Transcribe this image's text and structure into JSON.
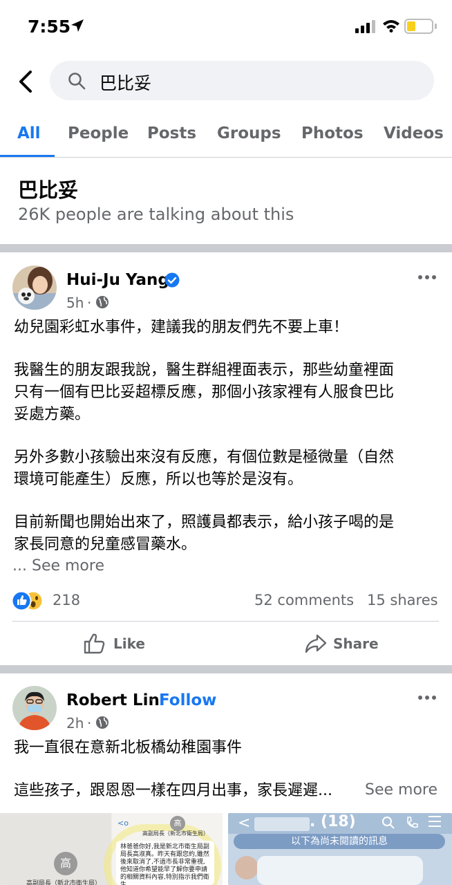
{
  "status_bar": {
    "time": "7:55"
  },
  "search": {
    "query": "巴比妥"
  },
  "tabs": [
    {
      "label": "All"
    },
    {
      "label": "People"
    },
    {
      "label": "Posts"
    },
    {
      "label": "Groups"
    },
    {
      "label": "Photos"
    },
    {
      "label": "Videos"
    }
  ],
  "topic": {
    "title": "巴比妥",
    "subtitle": "26K people are talking about this"
  },
  "post1": {
    "author": "Hui-Ju Yang",
    "time": "5h",
    "para1": "幼兒園彩虹水事件，建議我的朋友們先不要上車！",
    "para2_l1": "我醫生的朋友跟我說，醫生群組裡面表示，那些幼童裡面",
    "para2_l2": "只有一個有巴比妥超標反應，那個小孩家裡有人服食巴比",
    "para2_l3": "妥處方藥。",
    "para3_l1": "另外多數小孩驗出來沒有反應，有個位數是極微量（自然",
    "para3_l2": "環境可能產生）反應，所以也等於是沒有。",
    "para4_l1": "目前新聞也開始出來了，照護員都表示，給小孩子喝的是",
    "para4_l2": "家長同意的兒童感冒藥水。",
    "see_more": "... See more",
    "reaction_count": "218",
    "comments": "52 comments",
    "shares": "15 shares",
    "like_label": "Like",
    "share_label": "Share"
  },
  "post2": {
    "author": "Robert Lin",
    "follow": "Follow",
    "time": "2h",
    "line1": "我一直很在意新北板橋幼稚園事件",
    "line2": "這些孩子，跟恩恩一樣在四月出事，家長遲遲...",
    "see_more": "See more",
    "img1_label1": "高副局長（新北市衛生局）",
    "img1_label2": "高",
    "img1_label3": "高副局長（新北市衛生局）",
    "img1_text": "林爸爸你好,我是新北市衛生局副局長高淑真。昨天有跟您約,雖然後來取消了,不過市長非常重視,他知道你希望能早了解你要申請的相關資料內容,特別指示我們衛生",
    "img2_header": ". (18)",
    "img2_banner": "以下為尚未閱讀的訊息"
  },
  "colors": {
    "accent": "#1877f2",
    "secondary_text": "#65676b",
    "divider": "#c9ccd1"
  }
}
